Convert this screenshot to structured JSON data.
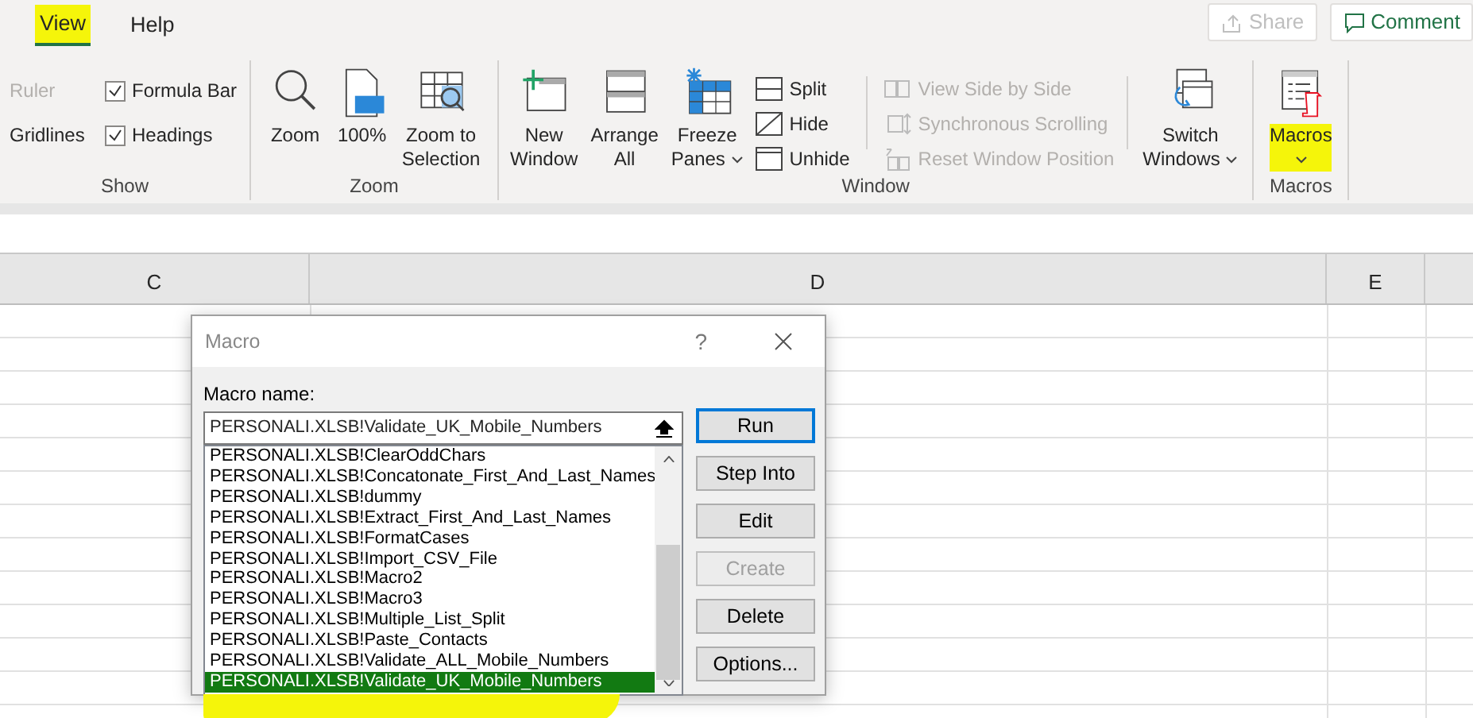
{
  "tabs": [
    {
      "label": "View",
      "selected": true,
      "highlighted": true
    },
    {
      "label": "Help",
      "selected": false,
      "highlighted": false
    }
  ],
  "top_buttons": [
    {
      "label": "Share",
      "disabled": true
    },
    {
      "label": "Comment",
      "disabled": false
    }
  ],
  "ribbon_groups": [
    {
      "kind": "show",
      "label": "Show",
      "options": [
        {
          "label": "Ruler",
          "disabled": true
        },
        {
          "label": "Gridlines",
          "disabled": false
        },
        {
          "label": "Formula Bar",
          "checked": true
        },
        {
          "label": "Headings",
          "checked": true
        }
      ]
    },
    {
      "kind": "large",
      "label": "Zoom",
      "buttons": [
        {
          "label": "Zoom",
          "dropdown": false
        },
        {
          "label": "100%",
          "dropdown": false
        },
        {
          "label": "Zoom to Selection",
          "dropdown": false
        }
      ]
    },
    {
      "kind": "window",
      "label": "Window",
      "buttons": [
        {
          "label": "New Window",
          "dropdown": false
        },
        {
          "label": "Arrange All",
          "dropdown": false
        },
        {
          "label": "Freeze Panes",
          "dropdown": true
        }
      ],
      "small_buttons": [
        {
          "label": "Split",
          "disabled": false
        },
        {
          "label": "Hide",
          "disabled": false
        },
        {
          "label": "Unhide",
          "disabled": false
        }
      ],
      "sync_buttons": [
        {
          "label": "View Side by Side",
          "disabled": true
        },
        {
          "label": "Synchronous Scrolling",
          "disabled": true
        },
        {
          "label": "Reset Window Position",
          "disabled": true
        }
      ],
      "switch_button": {
        "label": "Switch Windows",
        "dropdown": true
      }
    },
    {
      "kind": "large",
      "label": "Macros",
      "buttons": [
        {
          "label": "Macros",
          "dropdown": true,
          "highlighted": true
        }
      ]
    }
  ],
  "columns": [
    "C",
    "D",
    "E"
  ],
  "dialog": {
    "title": "Macro",
    "help": "?",
    "field_label": "Macro name:",
    "field_value": "PERSONALI.XLSB!Validate_UK_Mobile_Numbers",
    "macros": [
      {
        "label": "PERSONALI.XLSB!ClearOddChars",
        "selected": false
      },
      {
        "label": "PERSONALI.XLSB!Concatonate_First_And_Last_Names",
        "selected": false
      },
      {
        "label": "PERSONALI.XLSB!dummy",
        "selected": false
      },
      {
        "label": "PERSONALI.XLSB!Extract_First_And_Last_Names",
        "selected": false
      },
      {
        "label": "PERSONALI.XLSB!FormatCases",
        "selected": false
      },
      {
        "label": "PERSONALI.XLSB!Import_CSV_File",
        "selected": false
      },
      {
        "label": "PERSONALI.XLSB!Macro2",
        "selected": false
      },
      {
        "label": "PERSONALI.XLSB!Macro3",
        "selected": false
      },
      {
        "label": "PERSONALI.XLSB!Multiple_List_Split",
        "selected": false
      },
      {
        "label": "PERSONALI.XLSB!Paste_Contacts",
        "selected": false
      },
      {
        "label": "PERSONALI.XLSB!Validate_ALL_Mobile_Numbers",
        "selected": false
      },
      {
        "label": "PERSONALI.XLSB!Validate_UK_Mobile_Numbers",
        "selected": true,
        "highlighted": true
      }
    ],
    "buttons": [
      {
        "label": "Run",
        "default": true,
        "disabled": false
      },
      {
        "label": "Step Into",
        "default": false,
        "disabled": false
      },
      {
        "label": "Edit",
        "default": false,
        "disabled": false
      },
      {
        "label": "Create",
        "default": false,
        "disabled": true
      },
      {
        "label": "Delete",
        "default": false,
        "disabled": false
      },
      {
        "label": "Options...",
        "default": false,
        "disabled": false
      }
    ]
  }
}
